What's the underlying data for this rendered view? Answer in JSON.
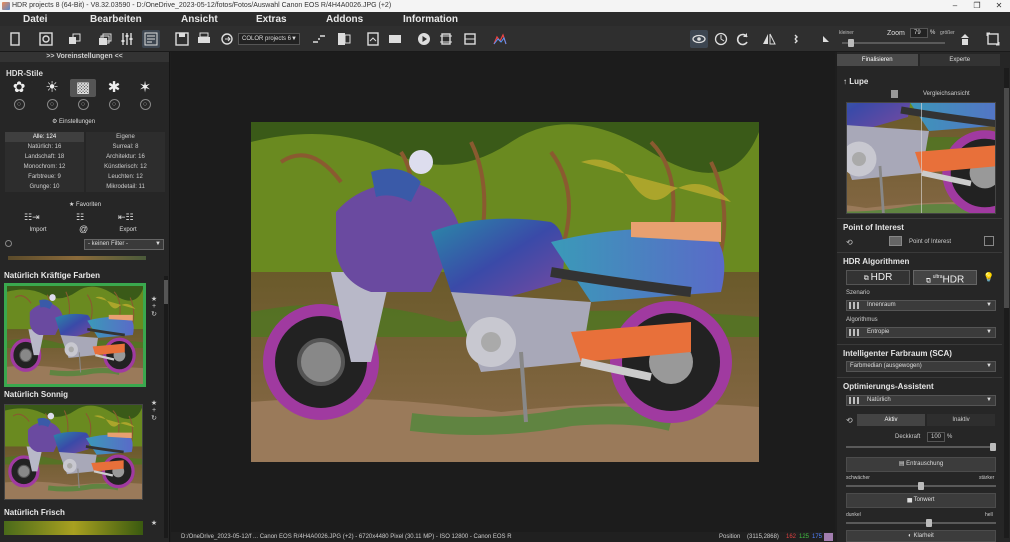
{
  "window": {
    "title": "HDR projects 8 (64-Bit) - V8.32.03590 - D:/OneDrive_2023-05-12/fotos/Fotos/Auswahl Canon EOS R/4H4A0026.JPG (+2)",
    "min": "–",
    "restore": "❐",
    "close": "✕"
  },
  "menu": [
    "Datei",
    "Bearbeiten",
    "Ansicht",
    "Extras",
    "Addons",
    "Information"
  ],
  "toolbar": {
    "preset_select": "COLOR projects 6",
    "zoom_label": "Zoom",
    "zoom_value": "79",
    "zoom_unit": "%",
    "smaller": "kleiner",
    "larger": "größer"
  },
  "left": {
    "presets_header": ">> Voreinstellungen <<",
    "hdr_styles_title": "HDR-Stile",
    "settings_label": "Einstellungen",
    "counts": [
      [
        "Alle: 124",
        "Eigene"
      ],
      [
        "Natürlich: 16",
        "Surreal: 8"
      ],
      [
        "Landschaft: 18",
        "Architektur: 16"
      ],
      [
        "Monochrom: 12",
        "Künstlerisch: 12"
      ],
      [
        "Farbtreue: 9",
        "Leuchten: 12"
      ],
      [
        "Grunge: 10",
        "Mikrodetail: 11"
      ]
    ],
    "favorites": "Favoriten",
    "import": "Import",
    "export": "Export",
    "filter": "- keinen Filter -",
    "preset_names": [
      "Natürlich Kräftige Farben",
      "Natürlich Sonnig",
      "Natürlich Frisch"
    ],
    "star": "★",
    "plus": "+",
    "cycle": "↻"
  },
  "right": {
    "tab_finalize": "Finalisieren",
    "tab_expert": "Experte",
    "loupe": "Lupe",
    "compare": "Vergleichsansicht",
    "poi": "Point of Interest",
    "poi_btn": "Point of Interest",
    "algorithms": "HDR Algorithmen",
    "hdr": "HDR",
    "ultra_hdr_small": "ultra",
    "ultra_hdr": "HDR",
    "scenario_label": "Szenario",
    "scenario": "Innenraum",
    "algorithm_label": "Algorithmus",
    "algorithm": "Entropie",
    "sca_title": "Intelligenter Farbraum (SCA)",
    "sca_value": "Farbmedian (ausgewogen)",
    "opt_title": "Optimierungs-Assistent",
    "opt_value": "Natürlich",
    "active": "Aktiv",
    "inactive": "Inaktiv",
    "opacity_label": "Deckkraft",
    "opacity_value": "100",
    "opacity_unit": "%",
    "denoise": "Entrauschung",
    "weaker": "schwächer",
    "stronger": "stärker",
    "tone": "Tonwert",
    "dark": "dunkel",
    "bright": "hell",
    "clarity": "Klarheit"
  },
  "status": {
    "file": "D:/OneDrive_2023-05-12/f ... Canon EOS R/4H4A0026.JPG (+2) - 6720x4480 Pixel (30.11 MP) - ISO 12800 - Canon EOS R",
    "position_label": "Position",
    "position": "(3115,2868)",
    "r": "162",
    "g": "125",
    "b": "175"
  },
  "colors": {
    "accent_green": "#3aa84e",
    "status_r": "#e04040",
    "status_g": "#40c040",
    "status_b": "#5080ff"
  }
}
